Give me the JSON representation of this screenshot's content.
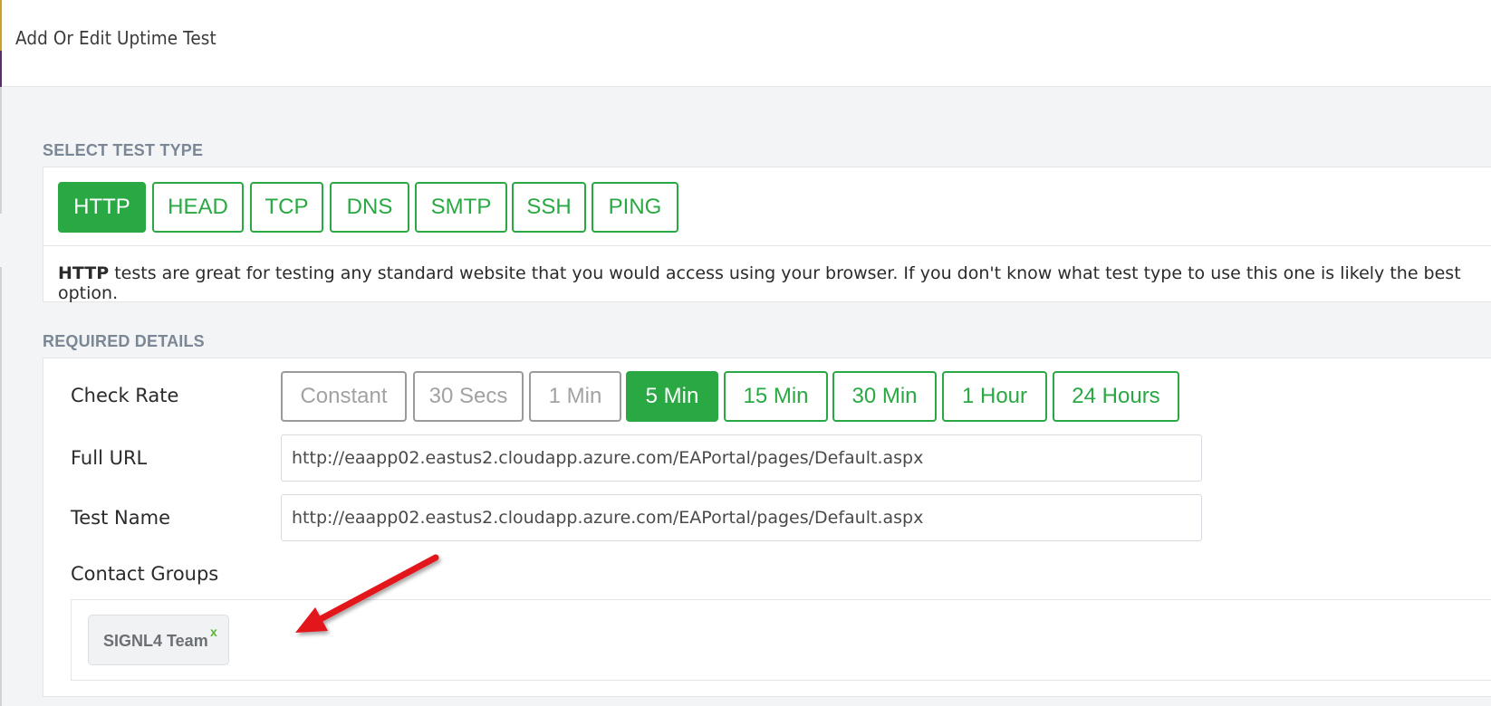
{
  "header": {
    "title": "Add Or Edit Uptime Test"
  },
  "test_type": {
    "section_label": "SELECT TEST TYPE",
    "options": [
      {
        "label": "HTTP",
        "state": "active"
      },
      {
        "label": "HEAD",
        "state": "normal"
      },
      {
        "label": "TCP",
        "state": "normal"
      },
      {
        "label": "DNS",
        "state": "normal"
      },
      {
        "label": "SMTP",
        "state": "normal"
      },
      {
        "label": "SSH",
        "state": "normal"
      },
      {
        "label": "PING",
        "state": "normal"
      }
    ],
    "description_bold": "HTTP",
    "description_text": " tests are great for testing any standard website that you would access using your browser. If you don't know what test type to use this one is likely the best option."
  },
  "required": {
    "section_label": "REQUIRED DETAILS",
    "check_rate": {
      "label": "Check Rate",
      "options": [
        {
          "label": "Constant",
          "state": "disabled"
        },
        {
          "label": "30 Secs",
          "state": "disabled"
        },
        {
          "label": "1 Min",
          "state": "disabled"
        },
        {
          "label": "5 Min",
          "state": "active"
        },
        {
          "label": "15 Min",
          "state": "normal"
        },
        {
          "label": "30 Min",
          "state": "normal"
        },
        {
          "label": "1 Hour",
          "state": "normal"
        },
        {
          "label": "24 Hours",
          "state": "normal"
        }
      ]
    },
    "full_url": {
      "label": "Full URL",
      "value": "http://eaapp02.eastus2.cloudapp.azure.com/EAPortal/pages/Default.aspx"
    },
    "test_name": {
      "label": "Test Name",
      "value": "http://eaapp02.eastus2.cloudapp.azure.com/EAPortal/pages/Default.aspx"
    },
    "contact_groups": {
      "label": "Contact Groups",
      "tags": [
        {
          "label": "SIGNL4 Team",
          "remove": "x"
        }
      ]
    }
  },
  "colors": {
    "accent_green": "#2aa843",
    "annotation_arrow": "#e3161b",
    "section_label": "#7b8794"
  },
  "annotation": {
    "icon": "red-arrow-icon"
  }
}
